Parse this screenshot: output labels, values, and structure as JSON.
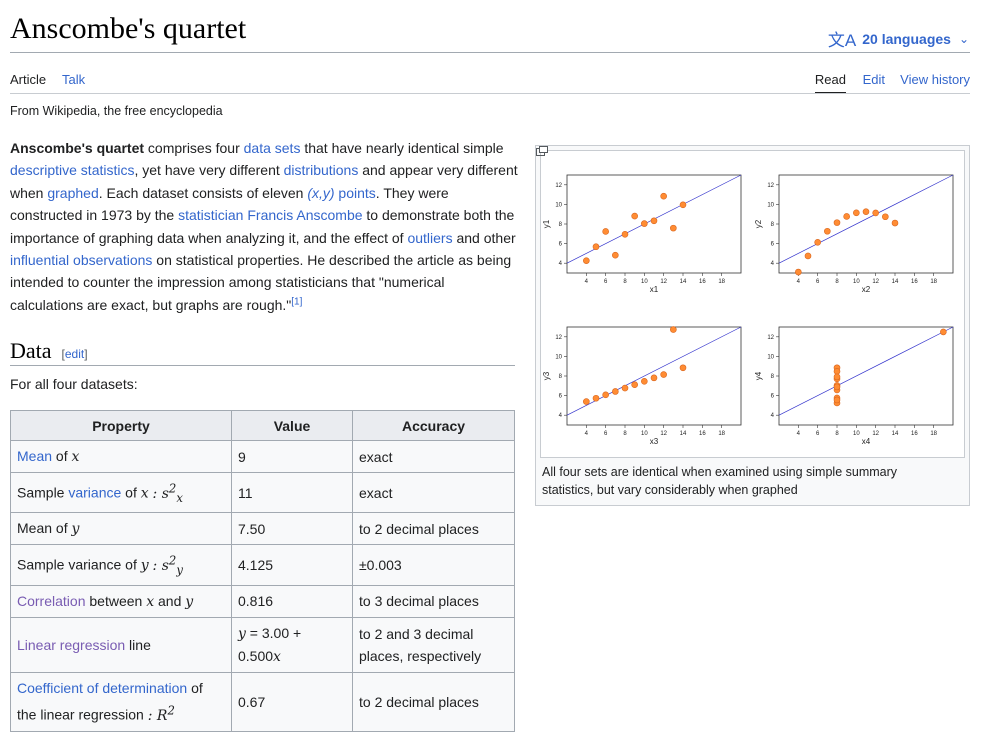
{
  "page": {
    "title": "Anscombe's quartet",
    "languages_label": "20 languages",
    "tabs": {
      "article": "Article",
      "talk": "Talk",
      "read": "Read",
      "edit": "Edit",
      "history": "View history"
    },
    "from": "From Wikipedia, the free encyclopedia"
  },
  "lead": {
    "term": "Anscombe's quartet",
    "t1": " comprises four ",
    "l_data_sets": "data sets",
    "t2": " that have nearly identical simple ",
    "l_desc_stats": "descriptive statistics",
    "t3": ", yet have very different ",
    "l_distributions": "distributions",
    "t4": " and appear very different when ",
    "l_graphed": "graphed",
    "t5": ". Each dataset consists of eleven ",
    "l_points_math": "(x,y)",
    "l_points": " points",
    "t6": ". They were constructed in 1973 by the ",
    "l_anscombe": "statistician Francis Anscombe",
    "t7": " to demonstrate both the importance of graphing data when analyzing it, and the effect of ",
    "l_outliers": "outliers",
    "t8": " and other ",
    "l_influential": "influential observations",
    "t9": " on statistical properties. He described the article as being intended to counter the impression among statisticians that \"numerical calculations are exact, but graphs are rough.\"",
    "ref": "[1]"
  },
  "data_section": {
    "heading": "Data",
    "edit_open": "[",
    "edit_link": "edit",
    "edit_close": "]",
    "intro": "For all four datasets:",
    "headers": [
      "Property",
      "Value",
      "Accuracy"
    ],
    "rows": [
      {
        "link": "Mean",
        "text": " of ",
        "math": "x",
        "value": "9",
        "accuracy": "exact"
      },
      {
        "pre": "Sample ",
        "link": "variance",
        "text": " of ",
        "math": "x",
        "symbol": ": s",
        "sup": "2",
        "sub": "x",
        "value": "11",
        "accuracy": "exact"
      },
      {
        "text": "Mean of ",
        "math": "y",
        "value": "7.50",
        "accuracy": "to 2 decimal places"
      },
      {
        "text": "Sample variance of ",
        "math": "y",
        "symbol": ": s",
        "sup": "2",
        "sub": "y",
        "value": "4.125",
        "accuracy": "±0.003"
      },
      {
        "link": "Correlation",
        "text": " between ",
        "math": "x",
        "text2": " and ",
        "math2": "y",
        "value": "0.816",
        "accuracy": "to 3 decimal places"
      },
      {
        "link": "Linear regression",
        "text": " line",
        "value_y": "y",
        "value_eq": " = 3.00 + 0.500",
        "value_x": "x",
        "accuracy": "to 2 and 3 decimal places, respectively"
      },
      {
        "link": "Coefficient of determination",
        "text": " of the linear regression ",
        "symbol": ": R",
        "sup": "2",
        "value": "0.67",
        "accuracy": "to 2 decimal places"
      }
    ]
  },
  "figure": {
    "caption": "All four sets are identical when examined using simple summary statistics, but vary considerably when graphed"
  },
  "chart_data": [
    {
      "type": "scatter",
      "title": "",
      "xlabel": "x1",
      "ylabel": "y1",
      "xticks": [
        4,
        6,
        8,
        10,
        12,
        14,
        16,
        18
      ],
      "yticks": [
        4,
        6,
        8,
        10,
        12
      ],
      "xlim": [
        2,
        20
      ],
      "ylim": [
        3,
        13
      ],
      "regression": {
        "intercept": 3.0,
        "slope": 0.5
      },
      "x": [
        10,
        8,
        13,
        9,
        11,
        14,
        6,
        4,
        12,
        7,
        5
      ],
      "y": [
        8.04,
        6.95,
        7.58,
        8.81,
        8.33,
        9.96,
        7.24,
        4.26,
        10.84,
        4.82,
        5.68
      ]
    },
    {
      "type": "scatter",
      "title": "",
      "xlabel": "x2",
      "ylabel": "y2",
      "xticks": [
        4,
        6,
        8,
        10,
        12,
        14,
        16,
        18
      ],
      "yticks": [
        4,
        6,
        8,
        10,
        12
      ],
      "xlim": [
        2,
        20
      ],
      "ylim": [
        3,
        13
      ],
      "regression": {
        "intercept": 3.0,
        "slope": 0.5
      },
      "x": [
        10,
        8,
        13,
        9,
        11,
        14,
        6,
        4,
        12,
        7,
        5
      ],
      "y": [
        9.14,
        8.14,
        8.74,
        8.77,
        9.26,
        8.1,
        6.13,
        3.1,
        9.13,
        7.26,
        4.74
      ]
    },
    {
      "type": "scatter",
      "title": "",
      "xlabel": "x3",
      "ylabel": "y3",
      "xticks": [
        4,
        6,
        8,
        10,
        12,
        14,
        16,
        18
      ],
      "yticks": [
        4,
        6,
        8,
        10,
        12
      ],
      "xlim": [
        2,
        20
      ],
      "ylim": [
        3,
        13
      ],
      "regression": {
        "intercept": 3.0,
        "slope": 0.5
      },
      "x": [
        10,
        8,
        13,
        9,
        11,
        14,
        6,
        4,
        12,
        7,
        5
      ],
      "y": [
        7.46,
        6.77,
        12.74,
        7.11,
        7.81,
        8.84,
        6.08,
        5.39,
        8.15,
        6.42,
        5.73
      ]
    },
    {
      "type": "scatter",
      "title": "",
      "xlabel": "x4",
      "ylabel": "y4",
      "xticks": [
        4,
        6,
        8,
        10,
        12,
        14,
        16,
        18
      ],
      "yticks": [
        4,
        6,
        8,
        10,
        12
      ],
      "xlim": [
        2,
        20
      ],
      "ylim": [
        3,
        13
      ],
      "regression": {
        "intercept": 3.0,
        "slope": 0.5
      },
      "x": [
        8,
        8,
        8,
        8,
        8,
        8,
        8,
        19,
        8,
        8,
        8
      ],
      "y": [
        6.58,
        5.76,
        7.71,
        8.84,
        8.47,
        7.04,
        5.25,
        12.5,
        5.56,
        7.91,
        6.89
      ]
    }
  ],
  "colors": {
    "link": "#3366cc",
    "visited": "#795cb2",
    "point_fill": "#ff8c33",
    "point_stroke": "#d9661f",
    "regression": "#3333cc"
  }
}
